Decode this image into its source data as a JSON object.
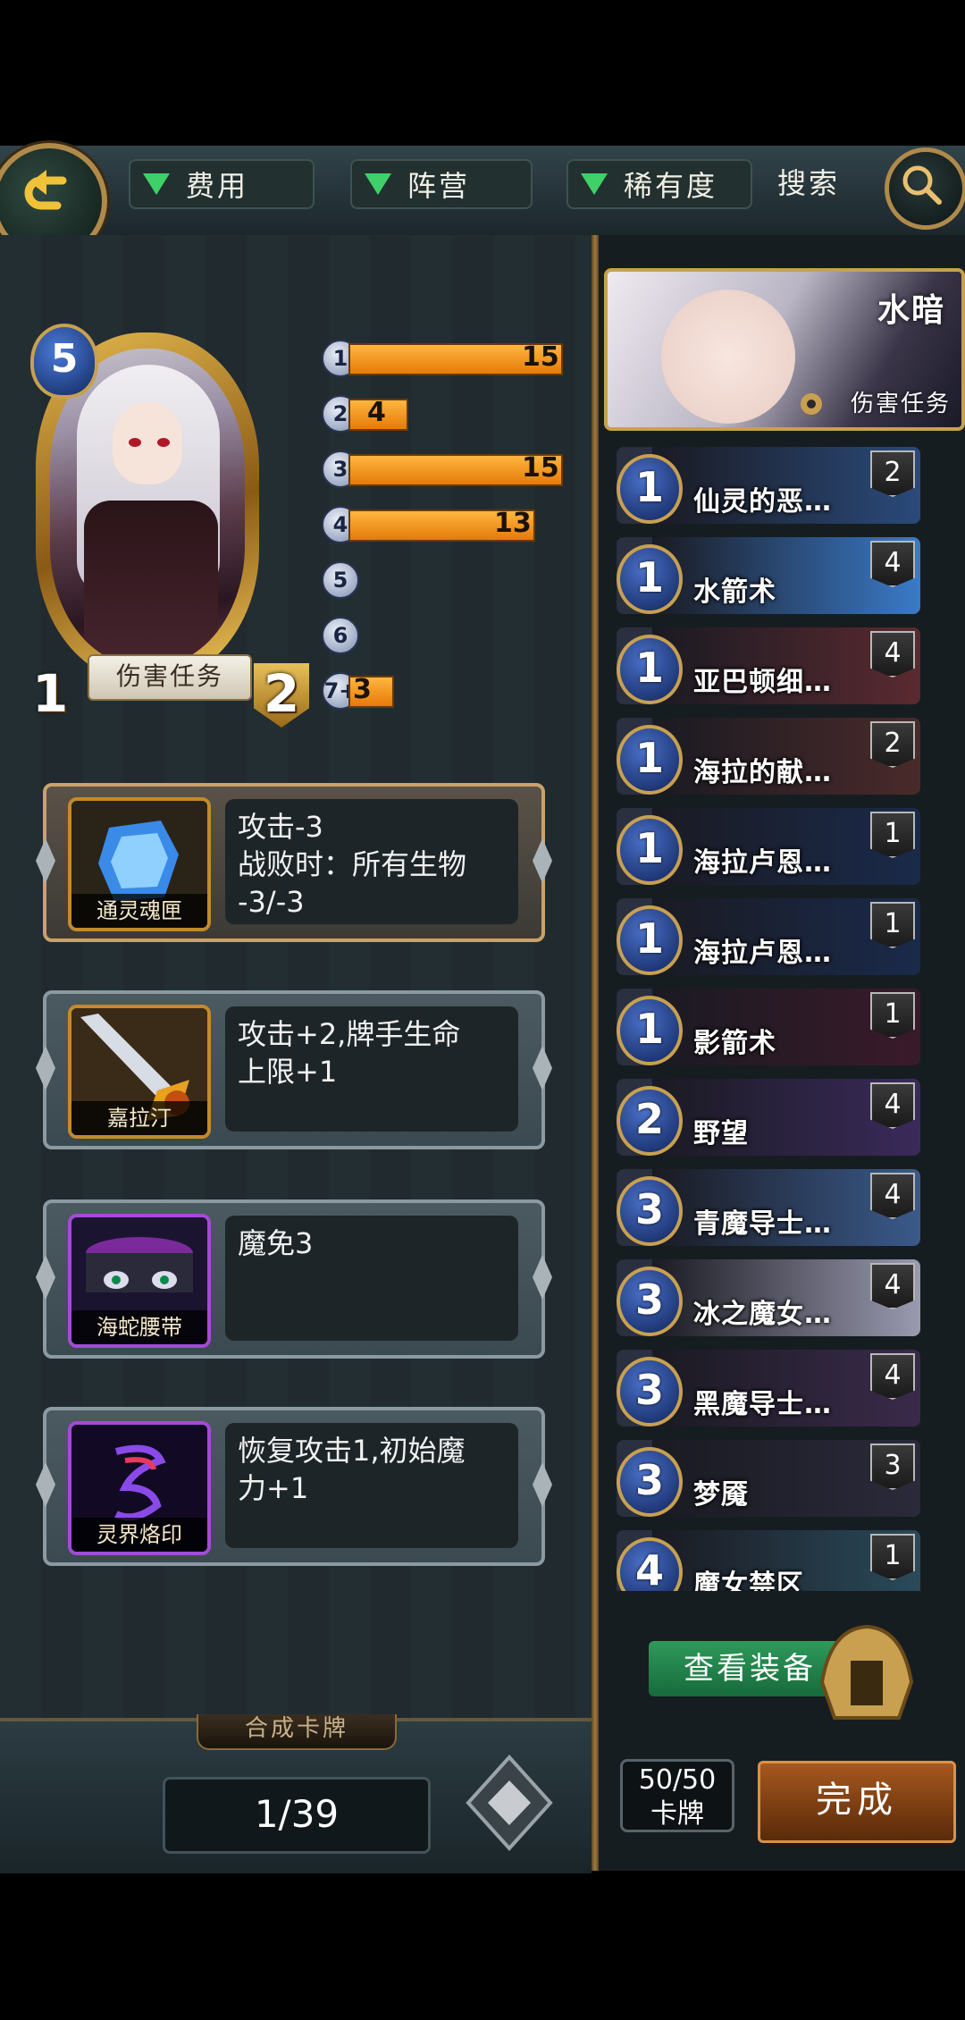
{
  "filters": {
    "cost": "费用",
    "faction": "阵营",
    "rarity": "稀有度",
    "search": "搜索"
  },
  "hero": {
    "cost": "5",
    "attack": "1",
    "health": "2",
    "tag": "伤害任务"
  },
  "mana_curve": [
    {
      "cost": "1",
      "count": "15",
      "value": 15
    },
    {
      "cost": "2",
      "count": "4",
      "value": 4
    },
    {
      "cost": "3",
      "count": "15",
      "value": 15
    },
    {
      "cost": "4",
      "count": "13",
      "value": 13
    },
    {
      "cost": "5",
      "count": "",
      "value": 0
    },
    {
      "cost": "6",
      "count": "",
      "value": 0
    },
    {
      "cost": "7+",
      "count": "3",
      "value": 3
    }
  ],
  "equipment": [
    {
      "name": "通灵魂匣",
      "desc": "攻击-3\n战败时：所有生物\n-3/-3"
    },
    {
      "name": "嘉拉汀",
      "desc": "攻击+2,牌手生命\n上限+1"
    },
    {
      "name": "海蛇腰带",
      "desc": "魔免3"
    },
    {
      "name": "灵界烙印",
      "desc": "恢复攻击1,初始魔\n力+1"
    }
  ],
  "bottom": {
    "merge_label": "合成卡牌",
    "page": "1/39"
  },
  "deck": {
    "hero_name": "水暗",
    "hero_tag": "伤害任务",
    "cards": [
      {
        "cost": "1",
        "name": "仙灵的恶…",
        "count": "2",
        "art": "#2a4a7a"
      },
      {
        "cost": "1",
        "name": "水箭术",
        "count": "4",
        "art": "#3a7ac8"
      },
      {
        "cost": "1",
        "name": "亚巴顿细…",
        "count": "4",
        "art": "#5a2a30"
      },
      {
        "cost": "1",
        "name": "海拉的献…",
        "count": "2",
        "art": "#4a2a2a"
      },
      {
        "cost": "1",
        "name": "海拉卢恩…",
        "count": "1",
        "art": "#1a2a4a"
      },
      {
        "cost": "1",
        "name": "海拉卢恩…",
        "count": "1",
        "art": "#1a2a4a"
      },
      {
        "cost": "1",
        "name": "影箭术",
        "count": "1",
        "art": "#3a1a2a"
      },
      {
        "cost": "2",
        "name": "野望",
        "count": "4",
        "art": "#3a2a5a"
      },
      {
        "cost": "3",
        "name": "青魔导士…",
        "count": "4",
        "art": "#3a5a8a"
      },
      {
        "cost": "3",
        "name": "冰之魔女…",
        "count": "4",
        "art": "#9a9ab0"
      },
      {
        "cost": "3",
        "name": "黑魔导士…",
        "count": "4",
        "art": "#3a2a4a"
      },
      {
        "cost": "3",
        "name": "梦魇",
        "count": "3",
        "art": "#2a2a3a"
      },
      {
        "cost": "4",
        "name": "魔女禁区",
        "count": "1",
        "art": "#2a4a5a"
      }
    ],
    "view_equipment": "查看装备",
    "card_count": "50/50",
    "card_count_unit": "卡牌",
    "done": "完成"
  }
}
